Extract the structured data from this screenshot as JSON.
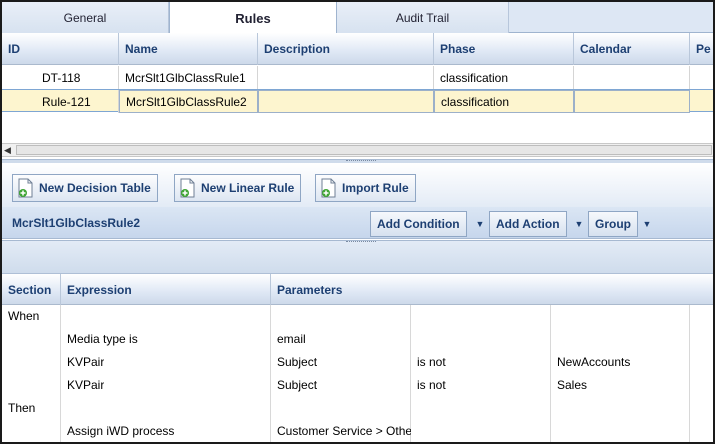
{
  "tabs": [
    {
      "label": "General",
      "active": false
    },
    {
      "label": "Rules",
      "active": true
    },
    {
      "label": "Audit Trail",
      "active": false
    }
  ],
  "rules_grid": {
    "columns": [
      "ID",
      "Name",
      "Description",
      "Phase",
      "Calendar",
      "Pe"
    ],
    "rows": [
      {
        "id": "DT-118",
        "name": "McrSlt1GlbClassRule1",
        "description": "",
        "phase": "classification",
        "calendar": "",
        "selected": false
      },
      {
        "id": "Rule-121",
        "name": "McrSlt1GlbClassRule2",
        "description": "",
        "phase": "classification",
        "calendar": "",
        "selected": true
      }
    ]
  },
  "toolbar": {
    "new_decision_table": "New Decision Table",
    "new_linear_rule": "New Linear Rule",
    "import_rule": "Import Rule"
  },
  "rule_bar": {
    "title": "McrSlt1GlbClassRule2",
    "add_condition": "Add Condition",
    "add_action": "Add Action",
    "group": "Group"
  },
  "expression_grid": {
    "columns": [
      "Section",
      "Expression",
      "Parameters"
    ],
    "rows": [
      {
        "section": "When",
        "expression": "",
        "p1": "",
        "p2": "",
        "p3": ""
      },
      {
        "section": "",
        "expression": "Media type is",
        "p1": "email",
        "p2": "",
        "p3": ""
      },
      {
        "section": "",
        "expression": "KVPair",
        "p1": "Subject",
        "p2": "is not",
        "p3": "NewAccounts"
      },
      {
        "section": "",
        "expression": "KVPair",
        "p1": "Subject",
        "p2": "is not",
        "p3": "Sales"
      },
      {
        "section": "Then",
        "expression": "",
        "p1": "",
        "p2": "",
        "p3": ""
      },
      {
        "section": "",
        "expression": "Assign iWD process",
        "p1": "Customer Service > Othe",
        "p2": "",
        "p3": ""
      }
    ]
  },
  "colors": {
    "accent": "#1d3f72",
    "selection": "#fdf5cf",
    "header": "#dfe8f5"
  }
}
